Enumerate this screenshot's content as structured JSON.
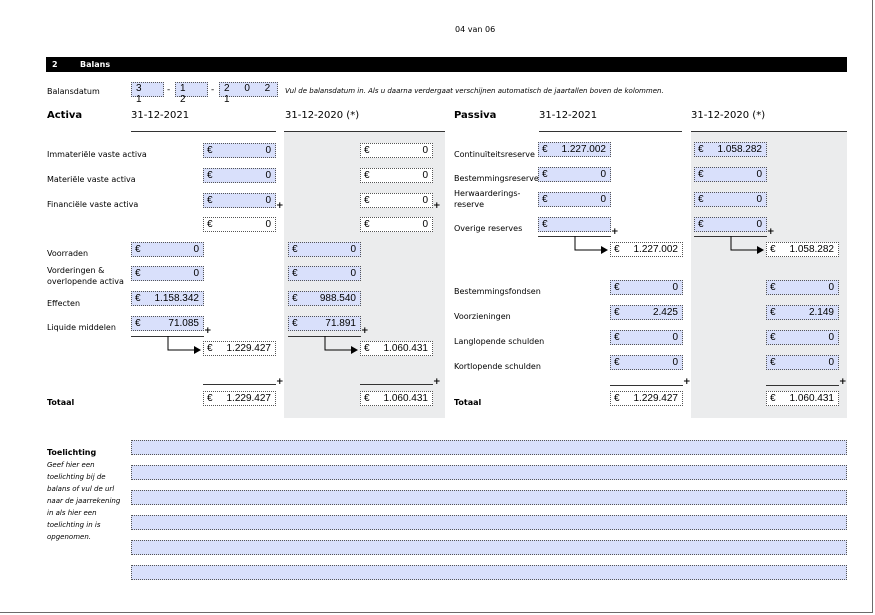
{
  "page_number": "04 van 06",
  "section": {
    "number": "2",
    "title": "Balans"
  },
  "balansdatum": {
    "label": "Balansdatum",
    "day": "3 1",
    "month": "1 2",
    "year": "2 0 2 1",
    "separator": "-",
    "hint": "Vul de balansdatum in. Als u daarna verdergaat verschijnen automatisch de jaartallen boven de kolommen."
  },
  "currency": "€",
  "activa": {
    "title": "Activa",
    "col_current": "31-12-2021",
    "col_previous": "31-12-2020 (*)",
    "rows": [
      {
        "label": "Immateriële vaste activa",
        "current": "0",
        "previous": "0"
      },
      {
        "label": "Materiële vaste activa",
        "current": "0",
        "previous": "0"
      },
      {
        "label": "Financiële vaste activa",
        "current": "0",
        "previous": "0"
      }
    ],
    "subtotal_fixed": {
      "current": "0",
      "previous": "0"
    },
    "current_rows": [
      {
        "label": "Voorraden",
        "current": "0",
        "previous": "0"
      },
      {
        "label": "Vorderingen & overlopende activa",
        "current": "0",
        "previous": "0"
      },
      {
        "label": "Effecten",
        "current": "1.158.342",
        "previous": "988.540"
      },
      {
        "label": "Liquide middelen",
        "current": "71.085",
        "previous": "71.891"
      }
    ],
    "subtotal_current": {
      "current": "1.229.427",
      "previous": "1.060.431"
    },
    "total": {
      "label": "Totaal",
      "current": "1.229.427",
      "previous": "1.060.431"
    }
  },
  "passiva": {
    "title": "Passiva",
    "col_current": "31-12-2021",
    "col_previous": "31-12-2020 (*)",
    "reserves": [
      {
        "label": "Continuïteitsreserve",
        "current": "1.227.002",
        "previous": "1.058.282"
      },
      {
        "label": "Bestemmingsreserve",
        "current": "0",
        "previous": "0"
      },
      {
        "label": "Herwaarderings-reserve",
        "current": "0",
        "previous": "0"
      },
      {
        "label": "Overige reserves",
        "current": "",
        "previous": "0"
      }
    ],
    "subtotal_reserves": {
      "current": "1.227.002",
      "previous": "1.058.282"
    },
    "other_rows": [
      {
        "label": "Bestemmingsfondsen",
        "current": "0",
        "previous": "0"
      },
      {
        "label": "Voorzieningen",
        "current": "2.425",
        "previous": "2.149"
      },
      {
        "label": "Langlopende schulden",
        "current": "0",
        "previous": "0"
      },
      {
        "label": "Kortlopende schulden",
        "current": "0",
        "previous": "0"
      }
    ],
    "total": {
      "label": "Totaal",
      "current": "1.229.427",
      "previous": "1.060.431"
    }
  },
  "toelichting": {
    "label": "Toelichting",
    "hint": "Geef hier een toelichting bij de balans of vul de url naar de jaarrekening in als hier een toelichting in is opgenomen."
  },
  "colors": {
    "field_fill": "#d9e0fb",
    "shade": "#ebeced",
    "section_bar": "#000000"
  }
}
